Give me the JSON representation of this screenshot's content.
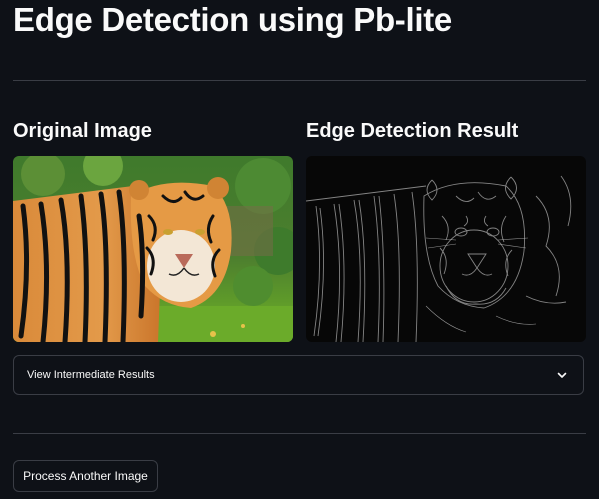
{
  "header": {
    "title": "Edge Detection using Pb-lite"
  },
  "columns": [
    {
      "heading": "Original Image",
      "image": "tiger photograph"
    },
    {
      "heading": "Edge Detection Result",
      "image": "tiger edge map"
    }
  ],
  "expander": {
    "label": "View Intermediate Results",
    "icon": "chevron-down-icon"
  },
  "actions": {
    "process_another_label": "Process Another Image"
  },
  "colors": {
    "background": "#0e1117",
    "text": "#fafafa",
    "border": "#3a3d45"
  }
}
